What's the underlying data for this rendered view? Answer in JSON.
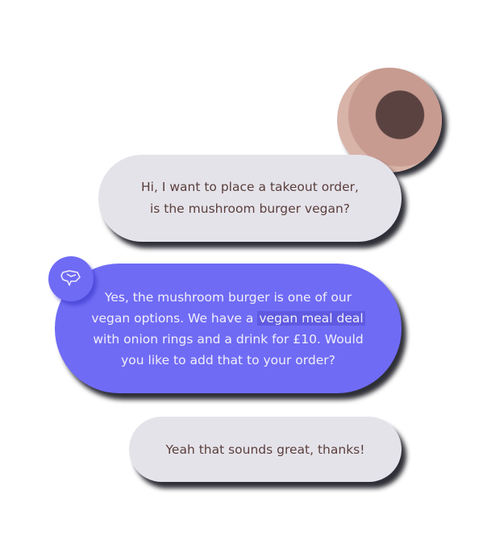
{
  "messages": [
    {
      "sender": "user",
      "lines": [
        "Hi, I want to place a takeout order,",
        "is the mushroom burger vegan?"
      ]
    },
    {
      "sender": "bot",
      "before": "Yes, the mushroom burger is one of our vegan options. We have a ",
      "highlight": "vegan meal deal",
      "after": " with onion rings and a drink for £10. Would you like to add that to your order?"
    },
    {
      "sender": "user",
      "text": "Yeah that sounds great, thanks!"
    }
  ],
  "colors": {
    "bot_bubble": "#6f6bf5",
    "user_bubble": "#e5e3ea",
    "user_text": "#5a3f3c"
  }
}
